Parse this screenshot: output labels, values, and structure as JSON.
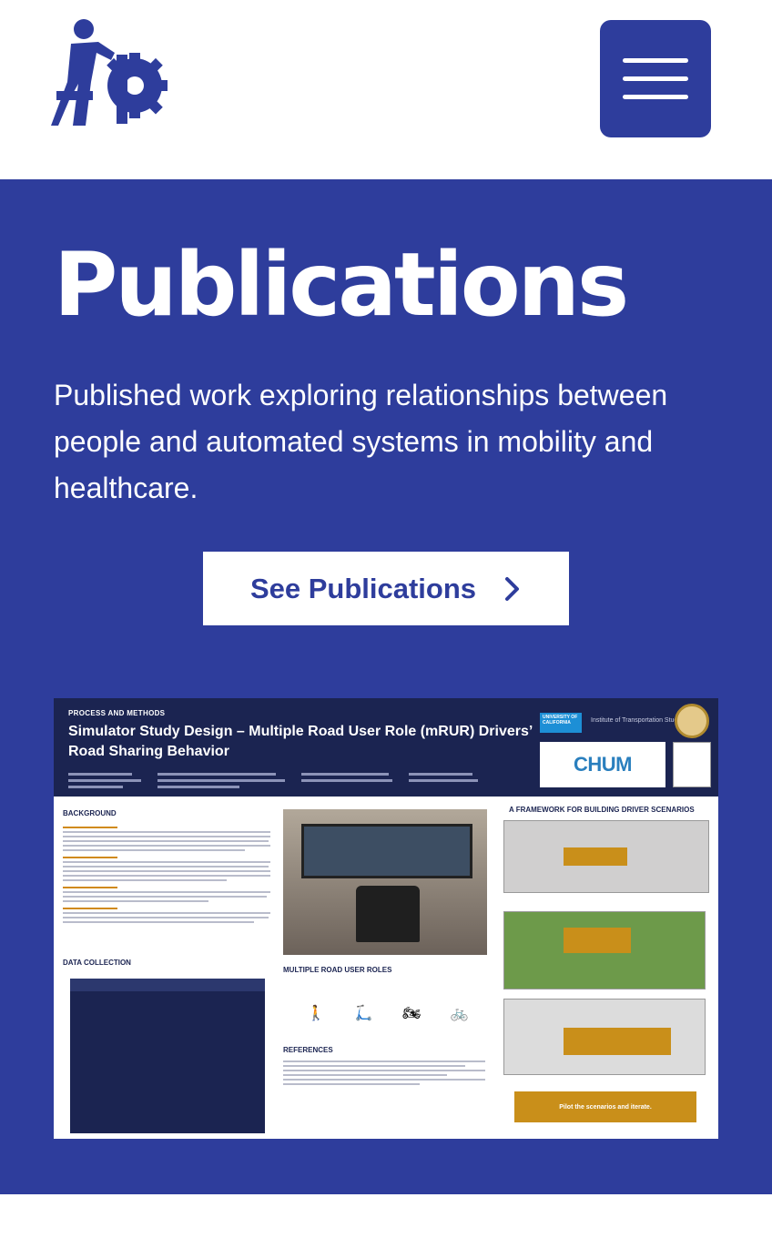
{
  "header": {
    "logo_icon": "ap-gear-logo-icon",
    "menu_icon": "hamburger-menu-icon",
    "brand_color": "#2e3d9c"
  },
  "hero": {
    "title": "Publications",
    "description": "Published work exploring relationships between people and automated systems in mobility and healthcare.",
    "cta_label": "See Publications",
    "cta_icon": "chevron-right-icon"
  },
  "poster": {
    "kicker": "PROCESS AND METHODS",
    "title": "Simulator Study Design – Multiple Road User Role (mRUR) Drivers’ Road Sharing Behavior",
    "uc_label": "UNIVERSITY OF CALIFORNIA",
    "its_label": "Institute of Transportation Studies",
    "chum_label": "CHUM",
    "sections": {
      "background": "BACKGROUND",
      "data_collection": "DATA COLLECTION",
      "road_user_roles": "MULTIPLE ROAD USER ROLES",
      "references": "REFERENCES",
      "framework": "A FRAMEWORK FOR BUILDING DRIVER SCENARIOS"
    },
    "pilot_label": "Pilot the scenarios and iterate."
  }
}
